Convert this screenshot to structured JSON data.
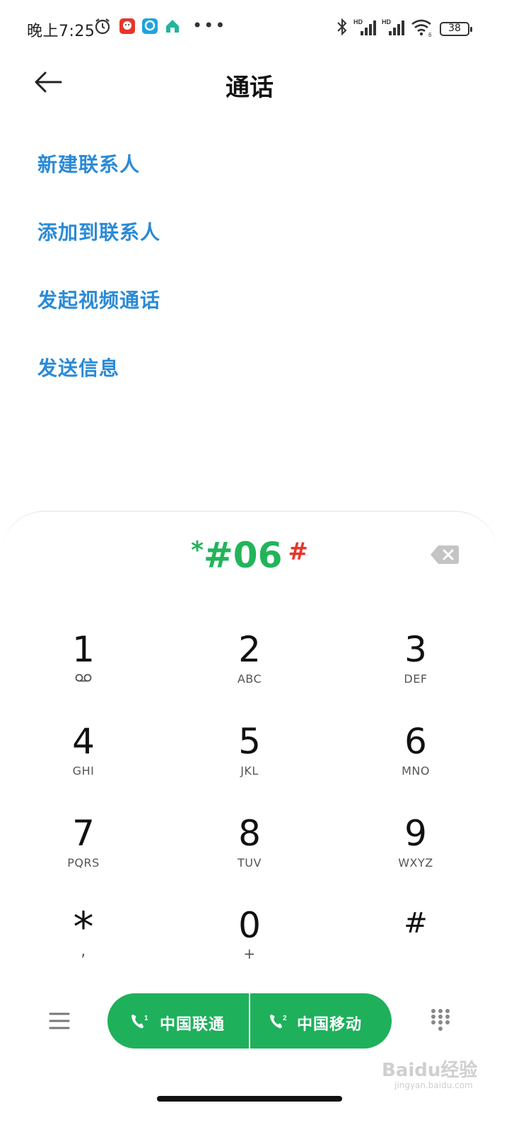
{
  "status_bar": {
    "time": "晚上7:25",
    "battery": "38",
    "icons": [
      "alarm-icon",
      "app-icon",
      "app-icon",
      "app-icon",
      "bluetooth-icon",
      "signal-hd-icon",
      "signal-hd-icon",
      "wifi-icon",
      "battery-icon"
    ]
  },
  "header": {
    "title": "通话"
  },
  "menu": {
    "items": [
      {
        "label": "新建联系人"
      },
      {
        "label": "添加到联系人"
      },
      {
        "label": "发起视频通话"
      },
      {
        "label": "发送信息"
      }
    ]
  },
  "dialer": {
    "number_prefix": "*",
    "number_main": "#06",
    "number_suffix": "#",
    "keys": [
      {
        "digit": "1",
        "letters": ""
      },
      {
        "digit": "2",
        "letters": "ABC"
      },
      {
        "digit": "3",
        "letters": "DEF"
      },
      {
        "digit": "4",
        "letters": "GHI"
      },
      {
        "digit": "5",
        "letters": "JKL"
      },
      {
        "digit": "6",
        "letters": "MNO"
      },
      {
        "digit": "7",
        "letters": "PQRS"
      },
      {
        "digit": "8",
        "letters": "TUV"
      },
      {
        "digit": "9",
        "letters": "WXYZ"
      },
      {
        "digit": "*",
        "letters": ","
      },
      {
        "digit": "0",
        "letters": "+"
      },
      {
        "digit": "#",
        "letters": ""
      }
    ],
    "sim1_label": "中国联通",
    "sim2_label": "中国移动"
  },
  "watermark": {
    "text": "Baidu经验",
    "sub": "jingyan.baidu.com"
  },
  "colors": {
    "accent_blue": "#2a8ad6",
    "call_green": "#1fb05c",
    "number_green": "#22b45a",
    "hash_red": "#e8352a"
  }
}
